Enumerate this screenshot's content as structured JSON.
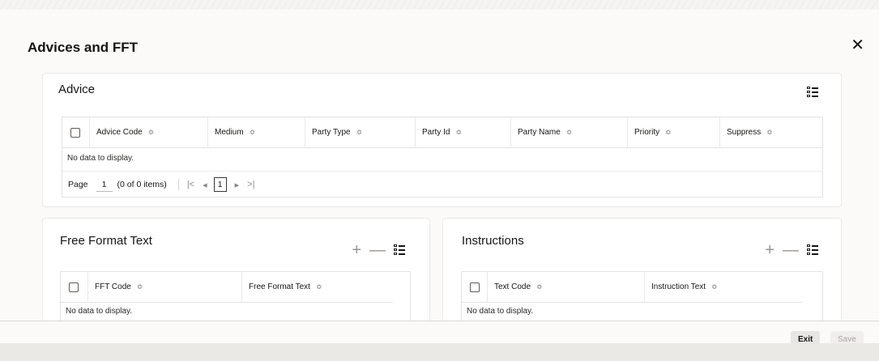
{
  "dialog": {
    "title": "Advices and FFT"
  },
  "advice": {
    "title": "Advice",
    "columns": [
      "Advice Code",
      "Medium",
      "Party Type",
      "Party Id",
      "Party Name",
      "Priority",
      "Suppress"
    ],
    "empty_text": "No data to display.",
    "pager": {
      "label": "Page",
      "page": "1",
      "items": "(0 of 0 items)",
      "current": "1"
    }
  },
  "fft": {
    "title": "Free Format Text",
    "columns": [
      "FFT Code",
      "Free Format Text"
    ],
    "empty_text": "No data to display."
  },
  "instructions": {
    "title": "Instructions",
    "columns": [
      "Text Code",
      "Instruction Text"
    ],
    "empty_text": "No data to display."
  },
  "footer": {
    "exit_label": "Exit",
    "save_label": "Save"
  },
  "icons": {
    "close": "close-icon",
    "add": "plus-icon",
    "remove": "minus-icon",
    "columns": "column-chooser-icon",
    "sort": "sort-icon",
    "first": "first-page-icon",
    "prev": "prev-page-icon",
    "next": "next-page-icon",
    "last": "last-page-icon"
  }
}
